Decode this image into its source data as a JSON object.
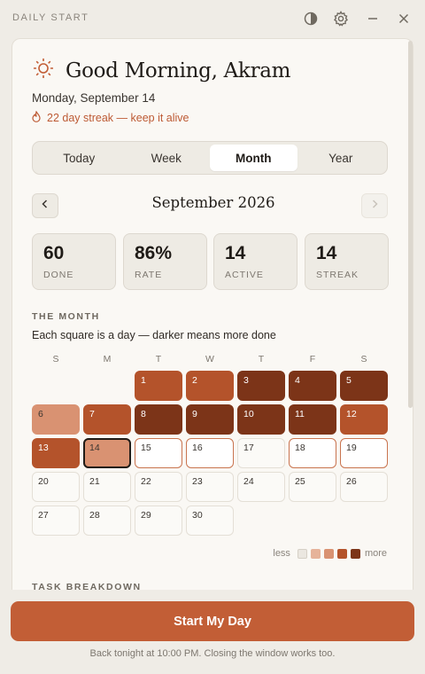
{
  "app": {
    "title": "DAILY START",
    "controls": [
      "contrast-icon",
      "gear-icon",
      "minimize-icon",
      "close-icon"
    ]
  },
  "header": {
    "greeting": "Good Morning, Akram",
    "date": "Monday, September 14",
    "streak": "22 day streak — keep it alive",
    "icon": "sun-icon"
  },
  "tabs": [
    "Today",
    "Week",
    "Month",
    "Year"
  ],
  "active_tab": "Month",
  "month_nav": {
    "label": "September 2026",
    "prev_icon": "chevron-left-icon",
    "next_icon": "chevron-right-icon",
    "next_disabled": true
  },
  "stats": [
    {
      "value": "60",
      "label": "DONE"
    },
    {
      "value": "86%",
      "label": "RATE"
    },
    {
      "value": "14",
      "label": "ACTIVE"
    },
    {
      "value": "14",
      "label": "STREAK"
    }
  ],
  "month_section": {
    "heading": "THE MONTH",
    "subtitle": "Each square is a day — darker means more done",
    "weekdays": [
      "S",
      "M",
      "T",
      "W",
      "T",
      "F",
      "S"
    ],
    "first_weekday_index": 2,
    "today": 14,
    "days": [
      {
        "day": 1,
        "level": 3
      },
      {
        "day": 2,
        "level": 3
      },
      {
        "day": 3,
        "level": 4
      },
      {
        "day": 4,
        "level": 4
      },
      {
        "day": 5,
        "level": 4
      },
      {
        "day": 6,
        "level": 2
      },
      {
        "day": 7,
        "level": 3
      },
      {
        "day": 8,
        "level": 4
      },
      {
        "day": 9,
        "level": 4
      },
      {
        "day": 10,
        "level": 4
      },
      {
        "day": 11,
        "level": 4
      },
      {
        "day": 12,
        "level": 3
      },
      {
        "day": 13,
        "level": 3
      },
      {
        "day": 14,
        "level": 2
      },
      {
        "day": 15,
        "level": "future"
      },
      {
        "day": 16,
        "level": "future"
      },
      {
        "day": 17,
        "level": 0
      },
      {
        "day": 18,
        "level": "future"
      },
      {
        "day": 19,
        "level": "future"
      },
      {
        "day": 20,
        "level": 0
      },
      {
        "day": 21,
        "level": 0
      },
      {
        "day": 22,
        "level": 0
      },
      {
        "day": 23,
        "level": 0
      },
      {
        "day": 24,
        "level": 0
      },
      {
        "day": 25,
        "level": 0
      },
      {
        "day": 26,
        "level": 0
      },
      {
        "day": 27,
        "level": 0
      },
      {
        "day": 28,
        "level": 0
      },
      {
        "day": 29,
        "level": 0
      },
      {
        "day": 30,
        "level": 0
      }
    ],
    "legend": {
      "less": "less",
      "more": "more",
      "colors": [
        "#ebe7e0",
        "#e6b39a",
        "#d99272",
        "#b4532b",
        "#7c3418"
      ]
    }
  },
  "task_section": {
    "heading": "TASK BREAKDOWN"
  },
  "cta": {
    "label": "Start My Day"
  },
  "footer": {
    "note": "Back tonight at 10:00 PM. Closing the window works too."
  },
  "colors": {
    "accent": "#c25e36",
    "background": "#efece6",
    "card": "#faf8f4"
  }
}
